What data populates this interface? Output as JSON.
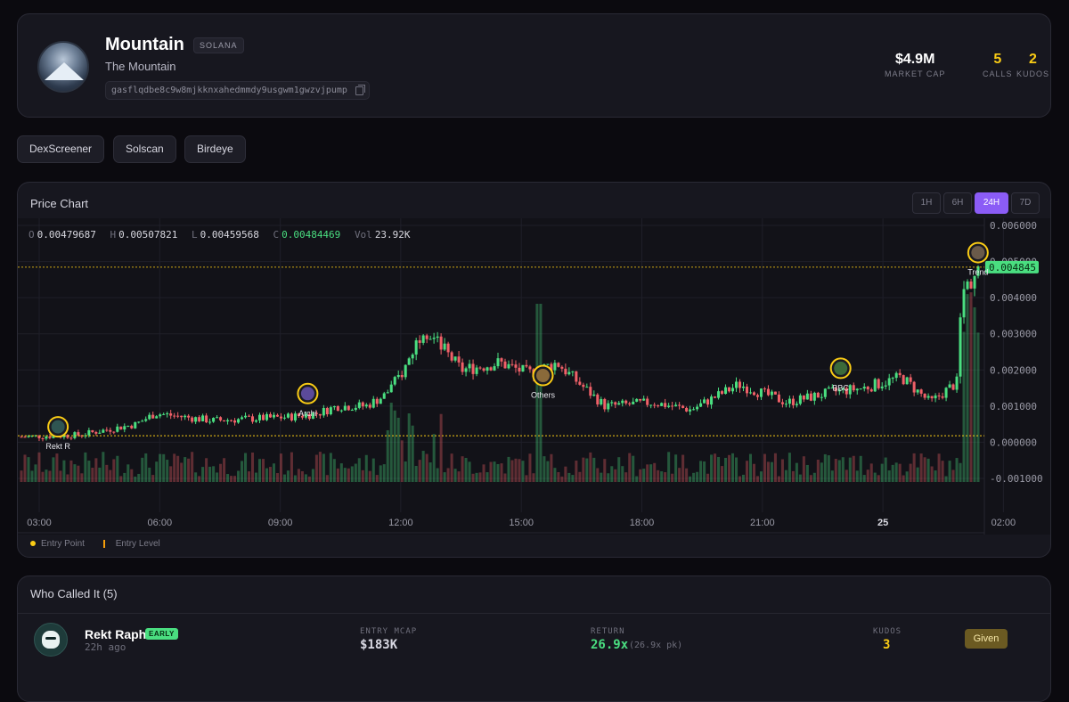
{
  "token": {
    "name": "Mountain",
    "chain": "SOLANA",
    "subtitle": "The Mountain",
    "address": "gasflqdbe8c9w8mjkknxahedmmdy9usgwm1gwzvjpump",
    "avatar_icon": "mountain-avatar"
  },
  "stats": {
    "market_cap": {
      "value": "$4.9M",
      "label": "MARKET CAP"
    },
    "calls": {
      "value": "5",
      "label": "CALLS"
    },
    "kudos": {
      "value": "2",
      "label": "KUDOS"
    }
  },
  "links": [
    "DexScreener",
    "Solscan",
    "Birdeye"
  ],
  "chart": {
    "title": "Price Chart",
    "timeframes": [
      "1H",
      "6H",
      "24H",
      "7D"
    ],
    "active_timeframe": "24H",
    "ohlc": {
      "o_label": "O",
      "o": "0.00479687",
      "h_label": "H",
      "h": "0.00507821",
      "l_label": "L",
      "l": "0.00459568",
      "c_label": "C",
      "c": "0.00484469",
      "vol_label": "Vol",
      "vol": "23.92K"
    },
    "legend": {
      "entry_point": "Entry Point",
      "entry_level": "Entry Level"
    },
    "colors": {
      "up": "#4ade80",
      "down": "#f06068",
      "entry": "#facc15",
      "accent": "#8b5cf6"
    }
  },
  "chart_data": {
    "type": "candlestick",
    "x_ticks": [
      "03:00",
      "06:00",
      "09:00",
      "12:00",
      "15:00",
      "18:00",
      "21:00",
      "25",
      "02:00"
    ],
    "y_ticks": [
      "0.006000",
      "0.005000",
      "0.004000",
      "0.003000",
      "0.002000",
      "0.001000",
      "0.000000",
      "-0.001000"
    ],
    "ylim": [
      -0.001,
      0.006
    ],
    "current_price_label": "0.004845",
    "current_price": 0.004845,
    "entry_level": 0.00018,
    "price_path": [
      [
        0,
        0.00015
      ],
      [
        0.06,
        0.0002
      ],
      [
        0.12,
        0.0005
      ],
      [
        0.14,
        0.0008
      ],
      [
        0.2,
        0.0006
      ],
      [
        0.28,
        0.0007
      ],
      [
        0.31,
        0.0008
      ],
      [
        0.33,
        0.001
      ],
      [
        0.36,
        0.001
      ],
      [
        0.38,
        0.0013
      ],
      [
        0.4,
        0.002
      ],
      [
        0.42,
        0.0032
      ],
      [
        0.44,
        0.0026
      ],
      [
        0.46,
        0.002
      ],
      [
        0.5,
        0.0022
      ],
      [
        0.53,
        0.0019
      ],
      [
        0.56,
        0.0022
      ],
      [
        0.58,
        0.0017
      ],
      [
        0.61,
        0.001
      ],
      [
        0.66,
        0.0011
      ],
      [
        0.7,
        0.0009
      ],
      [
        0.75,
        0.0016
      ],
      [
        0.78,
        0.0013
      ],
      [
        0.8,
        0.0011
      ],
      [
        0.85,
        0.0014
      ],
      [
        0.88,
        0.0015
      ],
      [
        0.92,
        0.0018
      ],
      [
        0.95,
        0.0011
      ],
      [
        0.98,
        0.0017
      ],
      [
        0.975,
        0.0019
      ],
      [
        0.985,
        0.0042
      ],
      [
        1.0,
        0.0048
      ]
    ],
    "callers": [
      {
        "name": "Rekt R",
        "x": 0.04,
        "price": 0.00018
      },
      {
        "name": "Archi",
        "x": 0.3,
        "price": 0.0011
      },
      {
        "name": "Others",
        "x": 0.545,
        "price": 0.0016
      },
      {
        "name": "BBC",
        "x": 0.855,
        "price": 0.0018
      },
      {
        "name": "Trend",
        "x": 0.998,
        "price": 0.005
      }
    ]
  },
  "who_called": {
    "title": "Who Called It (5)",
    "rows": [
      {
        "name": "Rekt Raph",
        "badge": "EARLY",
        "time": "22h ago",
        "entry_label": "ENTRY MCAP",
        "entry_value": "$183K",
        "return_label": "RETURN",
        "return_value": "26.9x",
        "return_peak": "(26.9x pk)",
        "kudos_label": "KUDOS",
        "kudos_value": "3",
        "button": "Given"
      }
    ]
  }
}
